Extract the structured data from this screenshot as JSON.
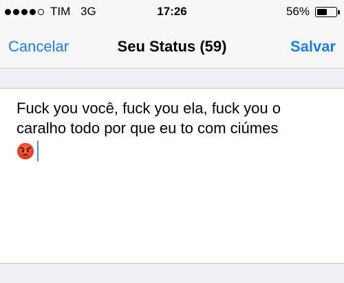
{
  "status_bar": {
    "carrier": "TIM",
    "network": "3G",
    "time": "17:26",
    "battery": "56%",
    "battery_level": 0.56,
    "signal_bars": 4,
    "signal_total": 5
  },
  "nav": {
    "cancel_label": "Cancelar",
    "title": "Seu Status (59)",
    "save_label": "Salvar"
  },
  "editor": {
    "text": "Fuck you você, fuck you ela, fuck you o caralho todo por que eu to com ciúmes",
    "emoji": "angry-face"
  },
  "colors": {
    "accent": "#1a7ee6",
    "background": "#efeff4",
    "bar": "#f7f7f7",
    "separator": "#c8c7cc",
    "cursor": "#4a8ef0"
  }
}
